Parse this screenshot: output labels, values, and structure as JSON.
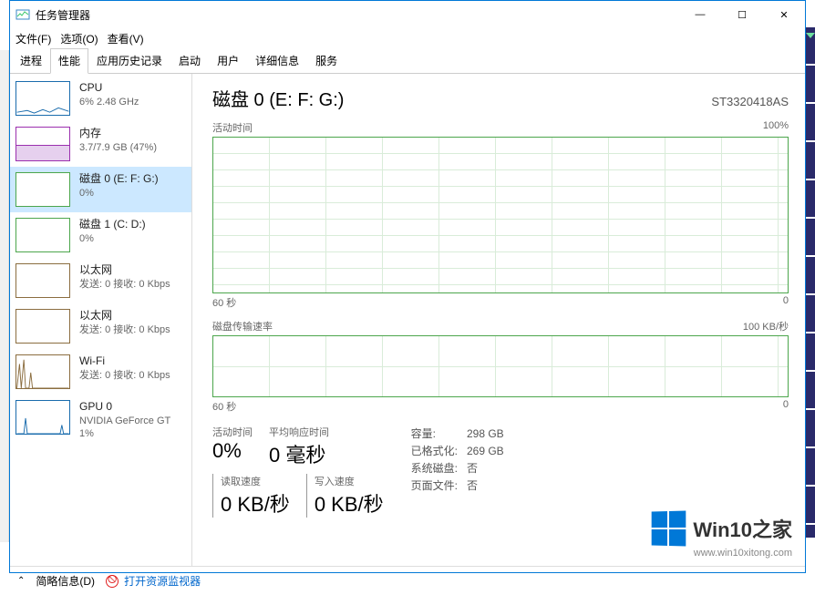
{
  "window": {
    "title": "任务管理器",
    "menu": {
      "file": "文件(F)",
      "options": "选项(O)",
      "view": "查看(V)"
    },
    "controls": {
      "min": "—",
      "max": "☐",
      "close": "✕"
    }
  },
  "tabs": [
    "进程",
    "性能",
    "应用历史记录",
    "启动",
    "用户",
    "详细信息",
    "服务"
  ],
  "sidebar": [
    {
      "name": "CPU",
      "sub": "6% 2.48 GHz",
      "kind": "cpu"
    },
    {
      "name": "内存",
      "sub": "3.7/7.9 GB (47%)",
      "kind": "mem"
    },
    {
      "name": "磁盘 0 (E: F: G:)",
      "sub": "0%",
      "kind": "disk",
      "selected": true
    },
    {
      "name": "磁盘 1 (C: D:)",
      "sub": "0%",
      "kind": "disk"
    },
    {
      "name": "以太网",
      "sub": "发送: 0 接收: 0 Kbps",
      "kind": "eth"
    },
    {
      "name": "以太网",
      "sub": "发送: 0 接收: 0 Kbps",
      "kind": "eth"
    },
    {
      "name": "Wi-Fi",
      "sub": "发送: 0 接收: 0 Kbps",
      "kind": "wifi"
    },
    {
      "name": "GPU 0",
      "sub": "NVIDIA GeForce GT\n1%",
      "kind": "gpu"
    }
  ],
  "main": {
    "title": "磁盘 0 (E: F: G:)",
    "model": "ST3320418AS",
    "chart1": {
      "label": "活动时间",
      "max": "100%",
      "xleft": "60 秒",
      "xright": "0"
    },
    "chart2": {
      "label": "磁盘传输速率",
      "max": "100 KB/秒",
      "xleft": "60 秒",
      "xright": "0"
    },
    "stats": {
      "active_label": "活动时间",
      "active": "0%",
      "avg_label": "平均响应时间",
      "avg": "0 毫秒",
      "read_label": "读取速度",
      "read": "0 KB/秒",
      "write_label": "写入速度",
      "write": "0 KB/秒"
    },
    "info": {
      "capacity_label": "容量:",
      "capacity": "298 GB",
      "formatted_label": "已格式化:",
      "formatted": "269 GB",
      "sysdisk_label": "系统磁盘:",
      "sysdisk": "否",
      "pagefile_label": "页面文件:",
      "pagefile": "否"
    }
  },
  "footer": {
    "brief": "简略信息(D)",
    "monitor": "打开资源监视器"
  },
  "watermark": {
    "brand": "Win10之家",
    "url": "www.win10xitong.com"
  },
  "chart_data": {
    "type": "line",
    "charts": [
      {
        "name": "活动时间",
        "ylim": [
          0,
          100
        ],
        "unit": "%",
        "x_span_seconds": 60,
        "values": []
      },
      {
        "name": "磁盘传输速率",
        "ylim": [
          0,
          100
        ],
        "unit": "KB/秒",
        "x_span_seconds": 60,
        "values": []
      }
    ]
  }
}
